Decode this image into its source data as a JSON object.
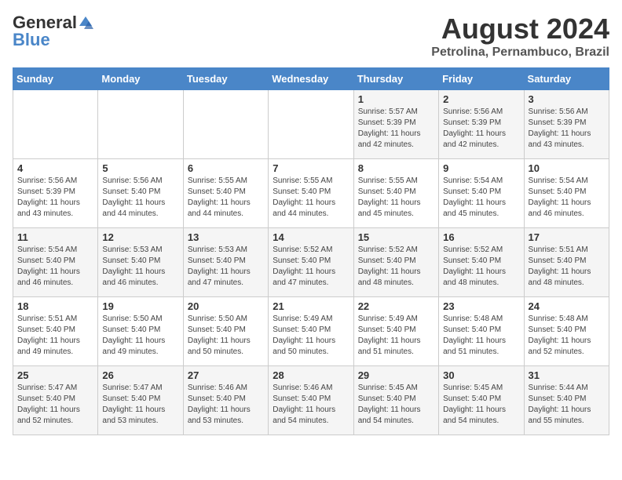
{
  "logo": {
    "general": "General",
    "blue": "Blue"
  },
  "title": {
    "month_year": "August 2024",
    "location": "Petrolina, Pernambuco, Brazil"
  },
  "weekdays": [
    "Sunday",
    "Monday",
    "Tuesday",
    "Wednesday",
    "Thursday",
    "Friday",
    "Saturday"
  ],
  "weeks": [
    [
      {
        "day": "",
        "info": ""
      },
      {
        "day": "",
        "info": ""
      },
      {
        "day": "",
        "info": ""
      },
      {
        "day": "",
        "info": ""
      },
      {
        "day": "1",
        "info": "Sunrise: 5:57 AM\nSunset: 5:39 PM\nDaylight: 11 hours\nand 42 minutes."
      },
      {
        "day": "2",
        "info": "Sunrise: 5:56 AM\nSunset: 5:39 PM\nDaylight: 11 hours\nand 42 minutes."
      },
      {
        "day": "3",
        "info": "Sunrise: 5:56 AM\nSunset: 5:39 PM\nDaylight: 11 hours\nand 43 minutes."
      }
    ],
    [
      {
        "day": "4",
        "info": "Sunrise: 5:56 AM\nSunset: 5:39 PM\nDaylight: 11 hours\nand 43 minutes."
      },
      {
        "day": "5",
        "info": "Sunrise: 5:56 AM\nSunset: 5:40 PM\nDaylight: 11 hours\nand 44 minutes."
      },
      {
        "day": "6",
        "info": "Sunrise: 5:55 AM\nSunset: 5:40 PM\nDaylight: 11 hours\nand 44 minutes."
      },
      {
        "day": "7",
        "info": "Sunrise: 5:55 AM\nSunset: 5:40 PM\nDaylight: 11 hours\nand 44 minutes."
      },
      {
        "day": "8",
        "info": "Sunrise: 5:55 AM\nSunset: 5:40 PM\nDaylight: 11 hours\nand 45 minutes."
      },
      {
        "day": "9",
        "info": "Sunrise: 5:54 AM\nSunset: 5:40 PM\nDaylight: 11 hours\nand 45 minutes."
      },
      {
        "day": "10",
        "info": "Sunrise: 5:54 AM\nSunset: 5:40 PM\nDaylight: 11 hours\nand 46 minutes."
      }
    ],
    [
      {
        "day": "11",
        "info": "Sunrise: 5:54 AM\nSunset: 5:40 PM\nDaylight: 11 hours\nand 46 minutes."
      },
      {
        "day": "12",
        "info": "Sunrise: 5:53 AM\nSunset: 5:40 PM\nDaylight: 11 hours\nand 46 minutes."
      },
      {
        "day": "13",
        "info": "Sunrise: 5:53 AM\nSunset: 5:40 PM\nDaylight: 11 hours\nand 47 minutes."
      },
      {
        "day": "14",
        "info": "Sunrise: 5:52 AM\nSunset: 5:40 PM\nDaylight: 11 hours\nand 47 minutes."
      },
      {
        "day": "15",
        "info": "Sunrise: 5:52 AM\nSunset: 5:40 PM\nDaylight: 11 hours\nand 48 minutes."
      },
      {
        "day": "16",
        "info": "Sunrise: 5:52 AM\nSunset: 5:40 PM\nDaylight: 11 hours\nand 48 minutes."
      },
      {
        "day": "17",
        "info": "Sunrise: 5:51 AM\nSunset: 5:40 PM\nDaylight: 11 hours\nand 48 minutes."
      }
    ],
    [
      {
        "day": "18",
        "info": "Sunrise: 5:51 AM\nSunset: 5:40 PM\nDaylight: 11 hours\nand 49 minutes."
      },
      {
        "day": "19",
        "info": "Sunrise: 5:50 AM\nSunset: 5:40 PM\nDaylight: 11 hours\nand 49 minutes."
      },
      {
        "day": "20",
        "info": "Sunrise: 5:50 AM\nSunset: 5:40 PM\nDaylight: 11 hours\nand 50 minutes."
      },
      {
        "day": "21",
        "info": "Sunrise: 5:49 AM\nSunset: 5:40 PM\nDaylight: 11 hours\nand 50 minutes."
      },
      {
        "day": "22",
        "info": "Sunrise: 5:49 AM\nSunset: 5:40 PM\nDaylight: 11 hours\nand 51 minutes."
      },
      {
        "day": "23",
        "info": "Sunrise: 5:48 AM\nSunset: 5:40 PM\nDaylight: 11 hours\nand 51 minutes."
      },
      {
        "day": "24",
        "info": "Sunrise: 5:48 AM\nSunset: 5:40 PM\nDaylight: 11 hours\nand 52 minutes."
      }
    ],
    [
      {
        "day": "25",
        "info": "Sunrise: 5:47 AM\nSunset: 5:40 PM\nDaylight: 11 hours\nand 52 minutes."
      },
      {
        "day": "26",
        "info": "Sunrise: 5:47 AM\nSunset: 5:40 PM\nDaylight: 11 hours\nand 53 minutes."
      },
      {
        "day": "27",
        "info": "Sunrise: 5:46 AM\nSunset: 5:40 PM\nDaylight: 11 hours\nand 53 minutes."
      },
      {
        "day": "28",
        "info": "Sunrise: 5:46 AM\nSunset: 5:40 PM\nDaylight: 11 hours\nand 54 minutes."
      },
      {
        "day": "29",
        "info": "Sunrise: 5:45 AM\nSunset: 5:40 PM\nDaylight: 11 hours\nand 54 minutes."
      },
      {
        "day": "30",
        "info": "Sunrise: 5:45 AM\nSunset: 5:40 PM\nDaylight: 11 hours\nand 54 minutes."
      },
      {
        "day": "31",
        "info": "Sunrise: 5:44 AM\nSunset: 5:40 PM\nDaylight: 11 hours\nand 55 minutes."
      }
    ]
  ]
}
